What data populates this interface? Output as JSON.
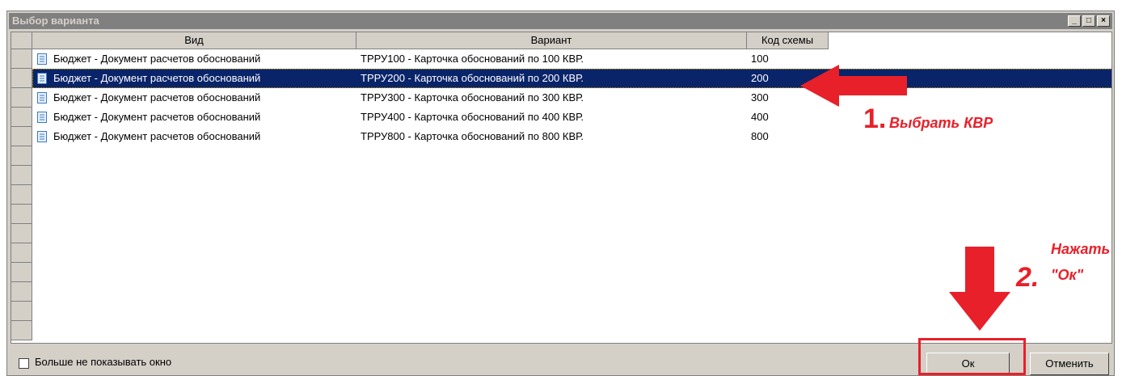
{
  "window": {
    "title": "Выбор варианта",
    "buttons": [
      "_",
      "□",
      "×"
    ]
  },
  "columns": [
    "Вид",
    "Вариант",
    "Код схемы"
  ],
  "rows": [
    {
      "type": "Бюджет - Документ расчетов обоснований",
      "variant": "ТРРУ100 - Карточка обоснований по 100 КВР.",
      "code": "100",
      "selected": false
    },
    {
      "type": "Бюджет - Документ расчетов обоснований",
      "variant": "ТРРУ200 - Карточка обоснований по 200 КВР.",
      "code": "200",
      "selected": true
    },
    {
      "type": "Бюджет - Документ расчетов обоснований",
      "variant": "ТРРУ300 - Карточка обоснований по 300 КВР.",
      "code": "300",
      "selected": false
    },
    {
      "type": "Бюджет - Документ расчетов обоснований",
      "variant": "ТРРУ400 - Карточка обоснований по 400 КВР.",
      "code": "400",
      "selected": false
    },
    {
      "type": "Бюджет - Документ расчетов обоснований",
      "variant": "ТРРУ800 - Карточка обоснований по 800 КВР.",
      "code": "800",
      "selected": false
    }
  ],
  "footer": {
    "checkbox_label": "Больше не показывать окно",
    "checkbox_checked": false,
    "ok_label": "Ок",
    "cancel_label": "Отменить"
  },
  "annotations": {
    "step1_num": "1.",
    "step1_text": "Выбрать КВР",
    "step2_num": "2.",
    "step2_text_line1": "Нажать",
    "step2_text_line2": "\"Ок\"",
    "color": "#e8202a"
  }
}
